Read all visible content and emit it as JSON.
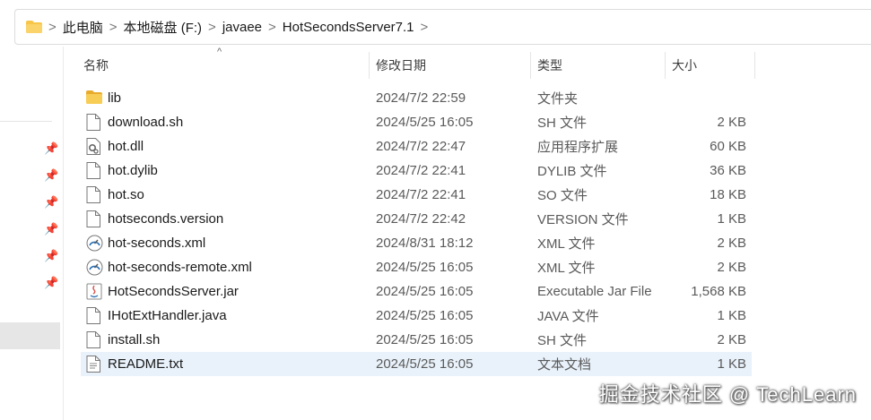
{
  "breadcrumb": [
    "此电脑",
    "本地磁盘 (F:)",
    "javaee",
    "HotSecondsServer7.1"
  ],
  "breadcrumb_separator": ">",
  "columns": {
    "name": "名称",
    "date": "修改日期",
    "type": "类型",
    "size": "大小"
  },
  "sort_indicator": "^",
  "files": [
    {
      "name": "lib",
      "date": "2024/7/2 22:59",
      "type": "文件夹",
      "size": "",
      "icon": "folder-icon"
    },
    {
      "name": "download.sh",
      "date": "2024/5/25 16:05",
      "type": "SH 文件",
      "size": "2 KB",
      "icon": "file-icon"
    },
    {
      "name": "hot.dll",
      "date": "2024/7/2 22:47",
      "type": "应用程序扩展",
      "size": "60 KB",
      "icon": "dll-icon"
    },
    {
      "name": "hot.dylib",
      "date": "2024/7/2 22:41",
      "type": "DYLIB 文件",
      "size": "36 KB",
      "icon": "file-icon"
    },
    {
      "name": "hot.so",
      "date": "2024/7/2 22:41",
      "type": "SO 文件",
      "size": "18 KB",
      "icon": "file-icon"
    },
    {
      "name": "hotseconds.version",
      "date": "2024/7/2 22:42",
      "type": "VERSION 文件",
      "size": "1 KB",
      "icon": "file-icon"
    },
    {
      "name": "hot-seconds.xml",
      "date": "2024/8/31 18:12",
      "type": "XML 文件",
      "size": "2 KB",
      "icon": "xml-icon"
    },
    {
      "name": "hot-seconds-remote.xml",
      "date": "2024/5/25 16:05",
      "type": "XML 文件",
      "size": "2 KB",
      "icon": "xml-icon"
    },
    {
      "name": "HotSecondsServer.jar",
      "date": "2024/5/25 16:05",
      "type": "Executable Jar File",
      "size": "1,568 KB",
      "icon": "jar-icon"
    },
    {
      "name": "IHotExtHandler.java",
      "date": "2024/5/25 16:05",
      "type": "JAVA 文件",
      "size": "1 KB",
      "icon": "file-icon"
    },
    {
      "name": "install.sh",
      "date": "2024/5/25 16:05",
      "type": "SH 文件",
      "size": "2 KB",
      "icon": "file-icon"
    },
    {
      "name": "README.txt",
      "date": "2024/5/25 16:05",
      "type": "文本文档",
      "size": "1 KB",
      "icon": "text-file-icon",
      "highlighted": true
    }
  ],
  "watermark": "掘金技术社区 @ TechLearn",
  "colors": {
    "folder": "#f7c548",
    "hover_row": "#e9f2fb"
  }
}
